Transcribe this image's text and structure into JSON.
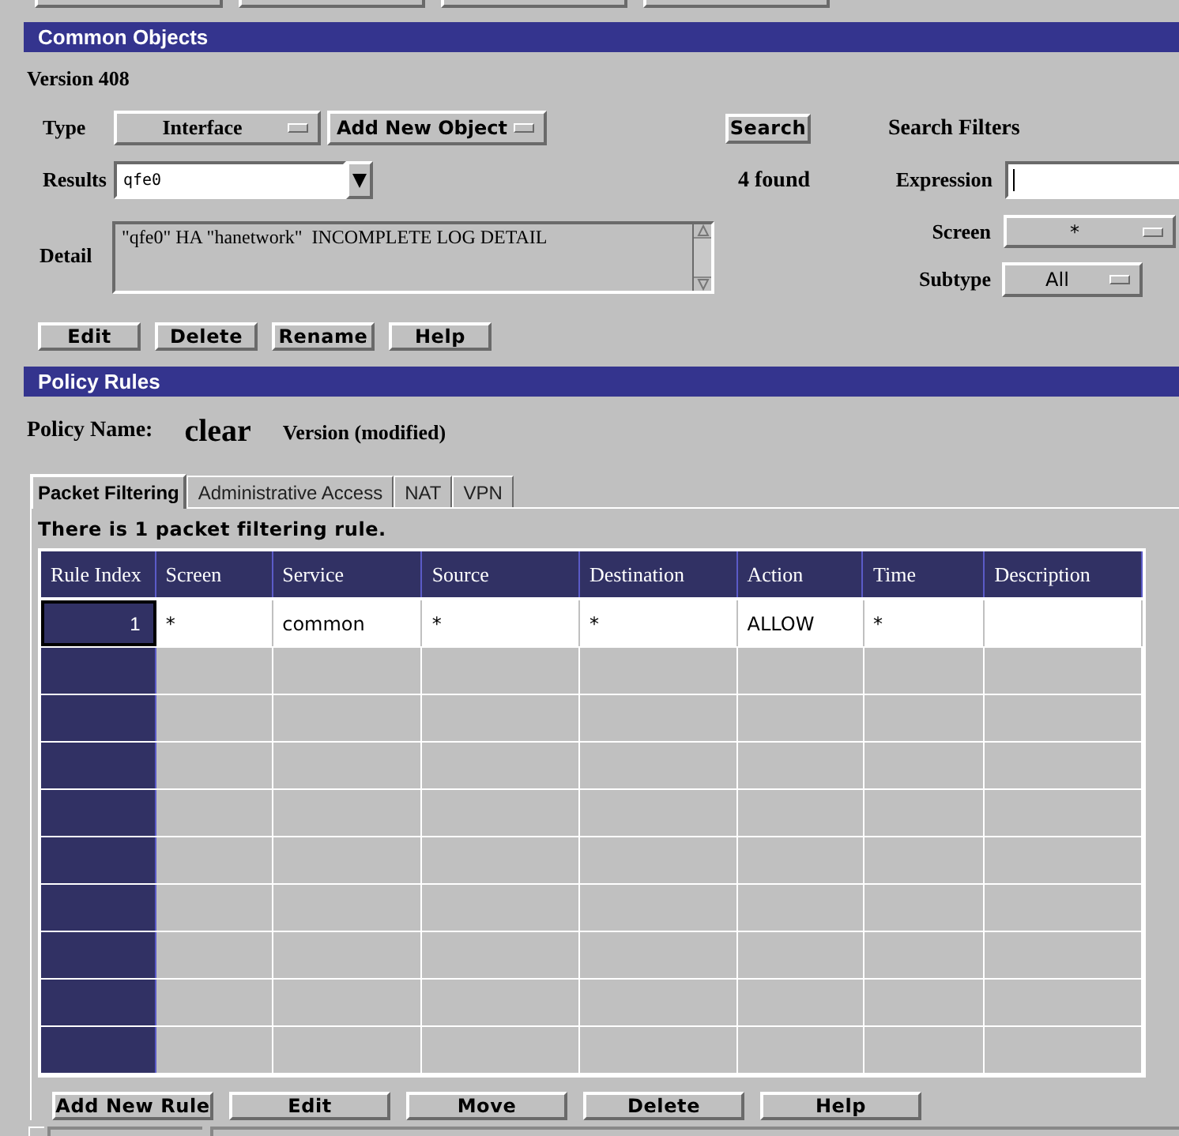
{
  "common_objects": {
    "title": "Common Objects",
    "version": "Version 408",
    "type": {
      "label": "Type",
      "value": "Interface"
    },
    "add_new_object": "Add New Object",
    "search_button": "Search",
    "results": {
      "label": "Results",
      "value": "qfe0",
      "count": "4 found"
    },
    "detail": {
      "label": "Detail",
      "value": "\"qfe0\" HA \"hanetwork\"  INCOMPLETE LOG DETAIL"
    },
    "search_filters": {
      "title": "Search Filters",
      "expression": {
        "label": "Expression"
      },
      "screen": {
        "label": "Screen",
        "value": "*"
      },
      "subtype": {
        "label": "Subtype",
        "value": "All"
      }
    },
    "buttons": [
      "Edit",
      "Delete",
      "Rename",
      "Help"
    ]
  },
  "policy_rules": {
    "title": "Policy Rules",
    "policy_name_label": "Policy Name:",
    "policy_name": "clear",
    "version": "Version (modified)",
    "tabs": [
      {
        "label": "Packet Filtering",
        "selected": true
      },
      {
        "label": "Administrative Access",
        "selected": false
      },
      {
        "label": "NAT",
        "selected": false
      },
      {
        "label": "VPN",
        "selected": false
      }
    ],
    "summary": "There is 1 packet filtering rule.",
    "table": {
      "columns": [
        "Rule Index",
        "Screen",
        "Service",
        "Source",
        "Destination",
        "Action",
        "Time",
        "Description"
      ],
      "rows": [
        {
          "selected": true,
          "cells": [
            "1",
            "*",
            "common",
            "*",
            "*",
            "ALLOW",
            "*",
            ""
          ]
        }
      ]
    },
    "buttons": [
      "Add New Rule",
      "Edit",
      "Move",
      "Delete",
      "Help"
    ]
  }
}
